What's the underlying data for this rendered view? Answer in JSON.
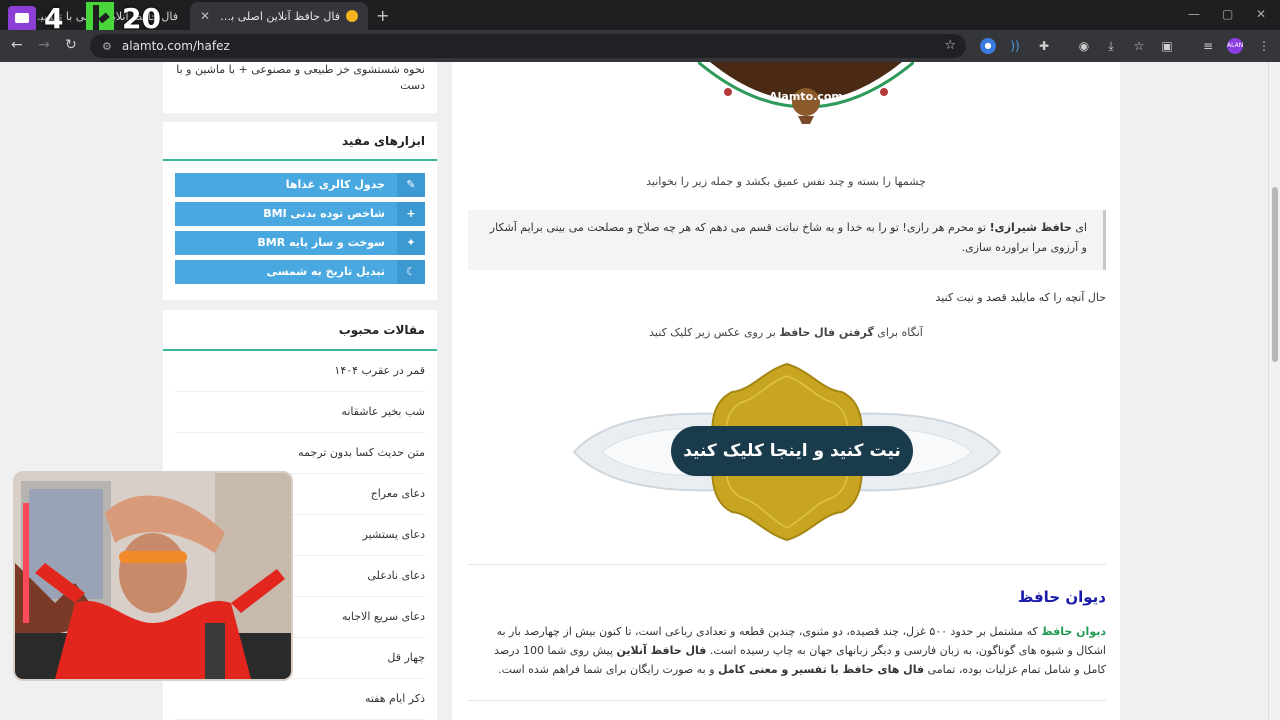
{
  "browser": {
    "tabs": [
      {
        "title": "فال حافظ آنلاین اصلی با تفسیر و تعبیر",
        "active": false
      },
      {
        "title": "فال حافظ آنلاین اصلی با تفسیر و تع...",
        "active": true
      }
    ],
    "url": "alamto.com/hafez",
    "newtab_symbol": "+",
    "close_symbol": "✕",
    "extension_badge": "ALAN"
  },
  "overlay": {
    "four": "4",
    "twenty": "20"
  },
  "sidebar": {
    "top_card_text": "نحوه شستشوی خز طبیعی و مصنوعی + با ماشین و با دست",
    "tools_title": "ابزارهای مفید",
    "tools": [
      {
        "label": "جدول کالری غذاها",
        "icon": "✎"
      },
      {
        "label": "شاخص توده بدنی BMI",
        "icon": "+"
      },
      {
        "label": "سوخت و ساز پایه BMR",
        "icon": "✦"
      },
      {
        "label": "تبدیل تاریخ به شمسی",
        "icon": "☾"
      }
    ],
    "articles_title": "مقالات محبوب",
    "articles": [
      "قمر در عقرب ۱۴۰۴",
      "شب بخیر عاشقانه",
      "متن حدیث کسا بدون ترجمه",
      "دعای معراج",
      "دعای یستشیر",
      "دعای نادعلی",
      "دعای سریع الاجابه",
      "چهار قل",
      "ذکر ایام هفته"
    ]
  },
  "main": {
    "watermark": "Alamto.com",
    "instruction": "چشمها را بسته و چند نفس عمیق بکشد و جمله زیر را بخوانید",
    "quote_prefix": "ای ",
    "quote_bold": "حافظ شیرازی!",
    "quote_text": " تو محرم هر رازی! تو را به خدا و به شاخ نباتت قسم می دهم که هر چه صلاح و مصلحت می بینی برایم آشکار و آرزوی مرا براورده سازی.",
    "intent": "حال آنچه را که مایلید قصد و نیت کنید",
    "click_prefix": "آنگاه برای ",
    "click_bold": "گرفتن فال حافظ",
    "click_suffix": " بر روی عکس زیر کلیک کنید",
    "banner_label": "نیت کنید و اینجا کلیک کنید",
    "section_title": "دیوان حافظ",
    "divan_link": "دیوان حافظ",
    "divan_p1": " که مشتمل بر حدود ۵۰۰ غزل، چند قصیده، دو مثنوی، چندین قطعه و تعدادی رباعی است، تا کنون بیش از چهارصد بار به اشکال و شیوه های گوناگون، به زبان فارسی و دیگر زبانهای جهان به چاپ رسیده است. ",
    "divan_bold1": "فال حافظ آنلاین",
    "divan_p2": " پیش روی شما 100 درصد کامل و شامل تمام غزلیات بوده، تمامی ",
    "divan_bold2": "فال های حافظ با تفسیر و معنی کامل",
    "divan_p3": " و به صورت رایگان برای شما فراهم شده است."
  }
}
